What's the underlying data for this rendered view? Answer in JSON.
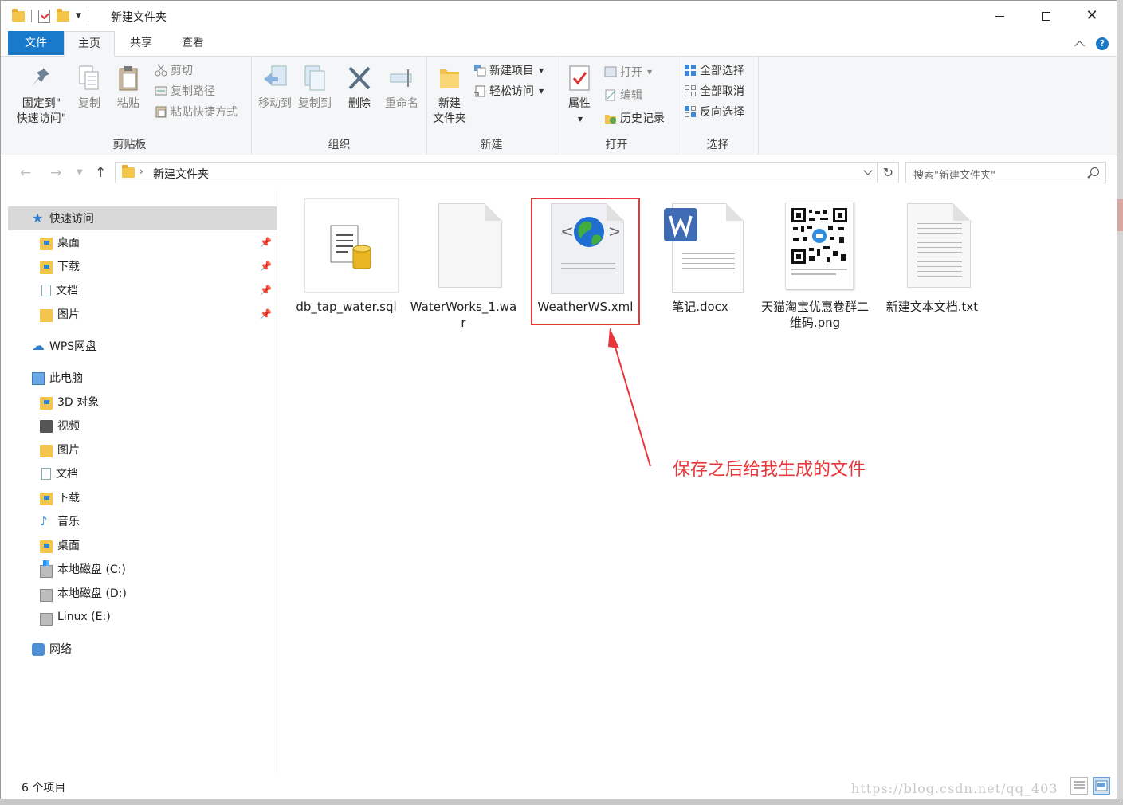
{
  "window": {
    "title": "新建文件夹"
  },
  "tabs": {
    "file": "文件",
    "home": "主页",
    "share": "共享",
    "view": "查看"
  },
  "ribbon": {
    "clipboard": {
      "label": "剪贴板",
      "pin_line1": "固定到\"",
      "pin_line2": "快速访问\"",
      "copy": "复制",
      "paste": "粘贴",
      "cut": "剪切",
      "copy_path": "复制路径",
      "paste_shortcut": "粘贴快捷方式"
    },
    "organize": {
      "label": "组织",
      "move_to": "移动到",
      "copy_to": "复制到",
      "delete": "删除",
      "rename": "重命名"
    },
    "new": {
      "label": "新建",
      "new_folder_line1": "新建",
      "new_folder_line2": "文件夹",
      "new_item": "新建项目",
      "easy_access": "轻松访问"
    },
    "open": {
      "label": "打开",
      "properties": "属性",
      "open": "打开",
      "edit": "编辑",
      "history": "历史记录"
    },
    "select": {
      "label": "选择",
      "select_all": "全部选择",
      "select_none": "全部取消",
      "invert": "反向选择"
    }
  },
  "address": {
    "current": "新建文件夹",
    "search_placeholder": "搜索\"新建文件夹\""
  },
  "nav": {
    "quick_access": "快速访问",
    "qa_desktop": "桌面",
    "qa_downloads": "下载",
    "qa_documents": "文档",
    "qa_pictures": "图片",
    "wps": "WPS网盘",
    "this_pc": "此电脑",
    "pc_3d": "3D 对象",
    "pc_video": "视频",
    "pc_pictures": "图片",
    "pc_documents": "文档",
    "pc_downloads": "下载",
    "pc_music": "音乐",
    "pc_desktop": "桌面",
    "drive_c": "本地磁盘 (C:)",
    "drive_d": "本地磁盘 (D:)",
    "drive_e": "Linux (E:)",
    "network": "网络"
  },
  "files": [
    {
      "name": "db_tap_water.sql"
    },
    {
      "name": "WaterWorks_1.war"
    },
    {
      "name": "WeatherWS.xml"
    },
    {
      "name": "笔记.docx"
    },
    {
      "name": "天猫淘宝优惠卷群二维码.png"
    },
    {
      "name": "新建文本文档.txt"
    }
  ],
  "annotation": "保存之后给我生成的文件",
  "status": {
    "count": "6 个项目"
  },
  "watermark": "https://blog.csdn.net/qq_403",
  "colors": {
    "accent": "#1979ca",
    "annotation": "#e8373b",
    "selection": "#d9d9d9"
  }
}
